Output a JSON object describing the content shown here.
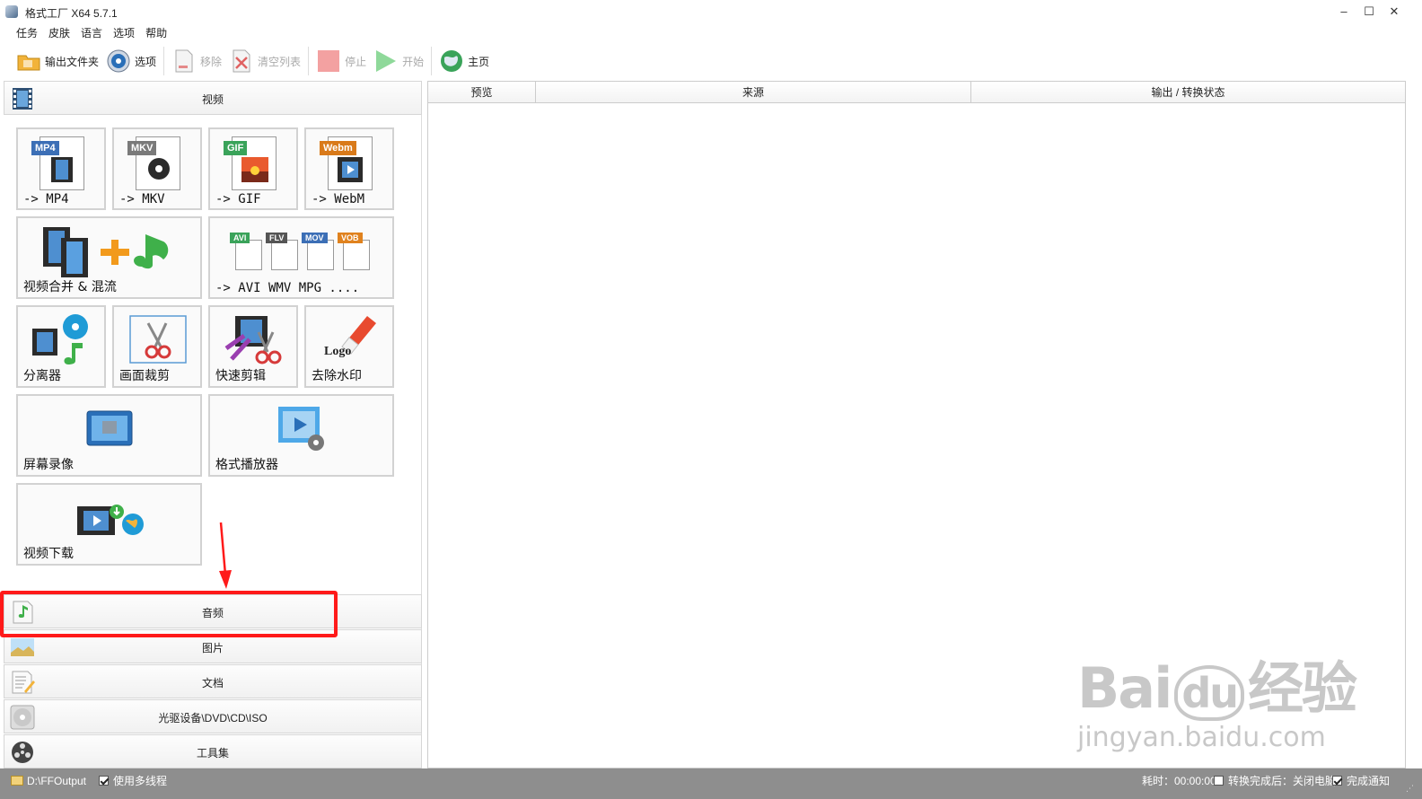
{
  "window": {
    "title": "格式工厂 X64 5.7.1",
    "minimize": "–",
    "maximize": "☐",
    "close": "✕"
  },
  "menu": [
    "任务",
    "皮肤",
    "语言",
    "选项",
    "帮助"
  ],
  "toolbar": {
    "output_folder": "输出文件夹",
    "options": "选项",
    "remove": "移除",
    "clear_list": "清空列表",
    "stop": "停止",
    "start": "开始",
    "home": "主页"
  },
  "categories": {
    "video": "视频",
    "audio": "音频",
    "image": "图片",
    "document": "文档",
    "disc": "光驱设备\\DVD\\CD\\ISO",
    "tools": "工具集"
  },
  "video_tiles": {
    "mp4": {
      "badge": "MP4",
      "label": "-> MP4",
      "badge_color": "#3c6fb6"
    },
    "mkv": {
      "badge": "MKV",
      "label": "-> MKV",
      "badge_color": "#7a7a7a"
    },
    "gif": {
      "badge": "GIF",
      "label": "-> GIF",
      "badge_color": "#3aa35a"
    },
    "webm": {
      "badge": "Webm",
      "label": "-> WebM",
      "badge_color": "#d97a1a"
    },
    "merge": {
      "label": "视频合并 & 混流"
    },
    "others": {
      "label": "-> AVI WMV MPG ....",
      "badges": [
        "AVI",
        "FLV",
        "MOV",
        "VOB"
      ]
    },
    "splitter": {
      "label": "分离器"
    },
    "crop": {
      "label": "画面裁剪"
    },
    "quick_cut": {
      "label": "快速剪辑"
    },
    "remove_logo": {
      "label": "去除水印",
      "logo_text": "Logo"
    },
    "screen_record": {
      "label": "屏幕录像"
    },
    "player": {
      "label": "格式播放器"
    },
    "download": {
      "label": "视频下载"
    }
  },
  "table": {
    "columns": [
      "预览",
      "来源",
      "输出 / 转换状态"
    ]
  },
  "statusbar": {
    "output_path": "D:\\FFOutput",
    "multithread": "使用多线程",
    "elapsed": "耗时：00:00:00",
    "after_convert": "转换完成后：关闭电脑",
    "notify": "完成通知"
  },
  "watermark": {
    "brand": "Bai",
    "brand_du": "du",
    "brand_cn": "经验",
    "url": "jingyan.baidu.com"
  },
  "colors": {
    "annotation_red": "#ff1a1a",
    "statusbar_bg": "#8e8e8e"
  }
}
